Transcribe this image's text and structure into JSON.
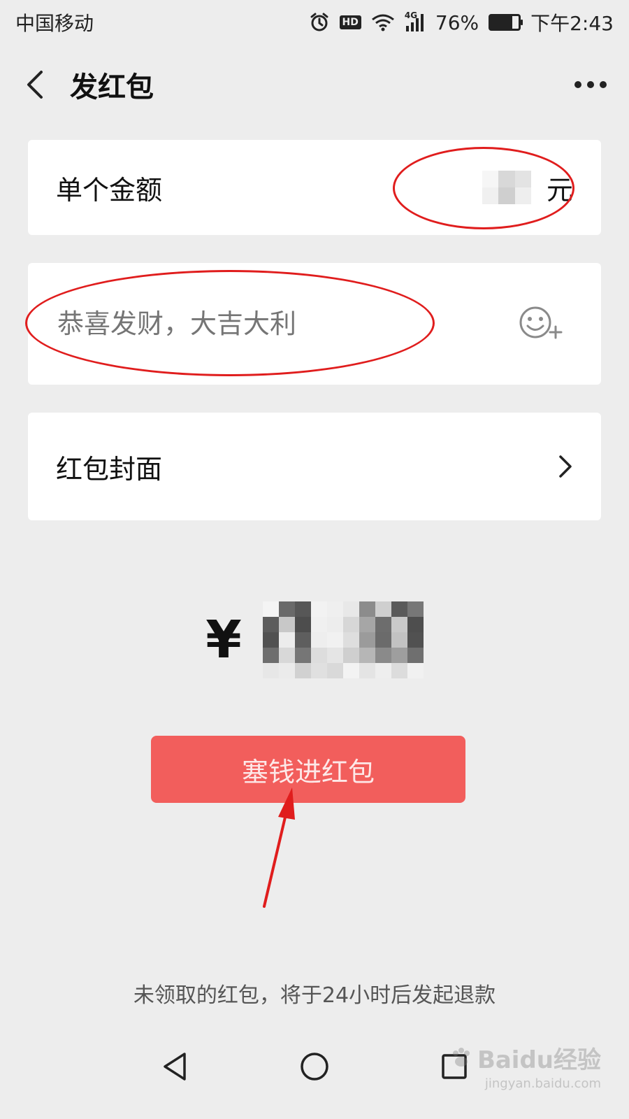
{
  "status_bar": {
    "carrier": "中国移动",
    "hd_badge": "HD",
    "network": "4G",
    "battery_percent": "76%",
    "battery_level": 0.76,
    "time": "下午2:43",
    "icons": [
      "alarm-icon",
      "hd-icon",
      "wifi-icon",
      "signal-icon",
      "battery-icon"
    ]
  },
  "header": {
    "title": "发红包",
    "back_icon": "back-chevron-icon",
    "more_icon": "more-dots-icon"
  },
  "amount_row": {
    "label": "单个金额",
    "unit": "元"
  },
  "message_row": {
    "placeholder": "恭喜发财，大吉大利",
    "emoji_icon": "emoji-plus-icon"
  },
  "cover_row": {
    "label": "红包封面",
    "chevron_icon": "chevron-right-icon"
  },
  "total": {
    "currency": "¥"
  },
  "primary_button": {
    "label": "塞钱进红包"
  },
  "refund_note": "未领取的红包，将于24小时后发起退款",
  "nav_bar": {
    "icons": [
      "back-triangle-icon",
      "home-circle-icon",
      "recents-square-icon"
    ]
  },
  "watermark": {
    "main": "Baidu经验",
    "sub": "jingyan.baidu.com"
  },
  "colors": {
    "background": "#ededed",
    "card": "#ffffff",
    "primary_button": "#f25e5c",
    "annotation_red": "#e01d1d",
    "placeholder": "#b2b2b2"
  }
}
